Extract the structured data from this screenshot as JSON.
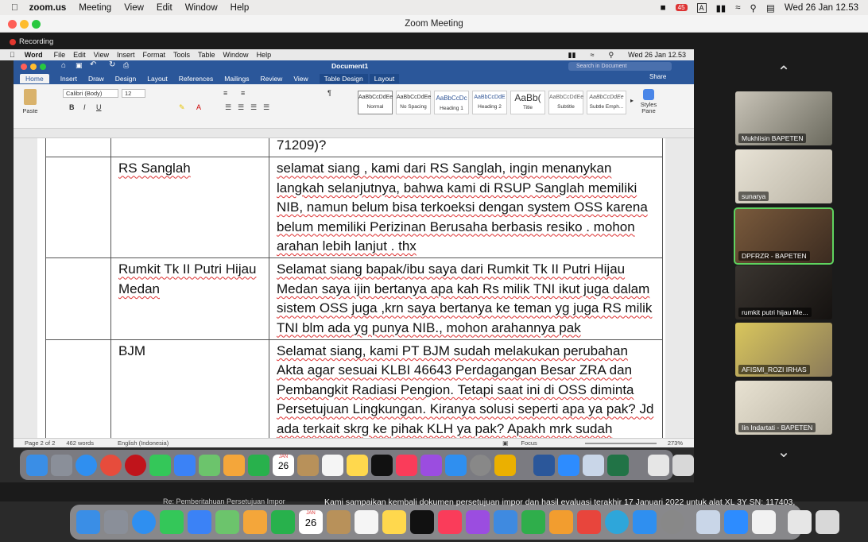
{
  "os_menubar": {
    "app_name": "zoom.us",
    "items": [
      "Meeting",
      "View",
      "Edit",
      "Window",
      "Help"
    ],
    "clock": "Wed 26 Jan  12.53",
    "badge": "45"
  },
  "zoom": {
    "window_title": "Zoom Meeting",
    "recording_label": "Recording"
  },
  "word": {
    "app_name": "Word",
    "menu_items": [
      "File",
      "Edit",
      "View",
      "Insert",
      "Format",
      "Tools",
      "Table",
      "Window",
      "Help"
    ],
    "clock": "Wed 26 Jan  12.53",
    "doc_title": "Document1",
    "search_placeholder": "Search in Document",
    "tabs": [
      "Home",
      "Insert",
      "Draw",
      "Design",
      "Layout",
      "References",
      "Mailings",
      "Review",
      "View",
      "Table Design",
      "Layout"
    ],
    "share_label": "Share",
    "paste_label": "Paste",
    "font_name": "Calibri (Body)",
    "font_size": "12",
    "styles": [
      {
        "preview": "AaBbCcDdEe",
        "name": "Normal"
      },
      {
        "preview": "AaBbCcDdEe",
        "name": "No Spacing"
      },
      {
        "preview": "AaBbCcDc",
        "name": "Heading 1"
      },
      {
        "preview": "AaBbCcDdE",
        "name": "Heading 2"
      },
      {
        "preview": "AaBb(",
        "name": "Title"
      },
      {
        "preview": "AaBbCcDdEe",
        "name": "Subtitle"
      },
      {
        "preview": "AaBbCcDdEe",
        "name": "Subtle Emph..."
      }
    ],
    "styles_pane_label": "Styles Pane",
    "status": {
      "page": "Page 2 of 2",
      "words": "462 words",
      "language": "English (Indonesia)",
      "focus": "Focus",
      "zoom": "273%"
    }
  },
  "table": {
    "top_fragment": "71209)?",
    "rows": [
      {
        "name": "RS Sanglah",
        "text": "selamat siang , kami  dari RS Sanglah, ingin menanykan langkah selanjutnya, bahwa kami di RSUP Sanglah memiliki NIB, namun belum bisa terkoeksi dengan system OSS karena belum memiliki Perizinan Berusaha berbasis resiko . mohon arahan lebih lanjut . thx"
      },
      {
        "name": "Rumkit Tk II Putri Hijau Medan",
        "text": "Selamat siang bapak/ibu saya dari Rumkit Tk II Putri Hijau Medan saya ijin bertanya apa kah Rs milik TNI  ikut juga dalam sistem OSS juga ,krn saya bertanya ke teman yg juga RS milik TNI blm ada yg punya NIB., mohon arahannya pak"
      },
      {
        "name": "BJM",
        "text": "Selamat siang, kami PT BJM sudah melakukan perubahan Akta agar sesuai KLBI 46643 Perdagangan Besar ZRA dan Pembangkit Radiasi Pengion. Tetapi saat ini di OSS diminta Persetujuan Lingkungan. Kiranya solusi seperti apa ya pak? Jd ada terkait skrg ke pihak KLH ya pak? Apakh mrk sudah"
      }
    ]
  },
  "participants": [
    {
      "name": "Mukhlisin BAPETEN"
    },
    {
      "name": "sunarya"
    },
    {
      "name": "DPFRZR - BAPETEN"
    },
    {
      "name": "rumkit putri hijau Me..."
    },
    {
      "name": "AFISMI_ROZI IRHAS"
    },
    {
      "name": "Iin Indartati - BAPETEN"
    }
  ],
  "background_text": {
    "left": "Re: Pemberitahuan Persetujuan Impor",
    "right": "Kami sampaikan kembali dokumen persetujuan impor dan hasil evaluasi terakhir 17 Januari 2022  untuk alat XL 3Y SN: 117403,"
  },
  "dock": {
    "calendar_month": "JAN",
    "calendar_day": "26"
  },
  "colors": {
    "word_blue": "#2b579a",
    "active_tile": "#5fd35f",
    "recording": "#e2372e"
  }
}
